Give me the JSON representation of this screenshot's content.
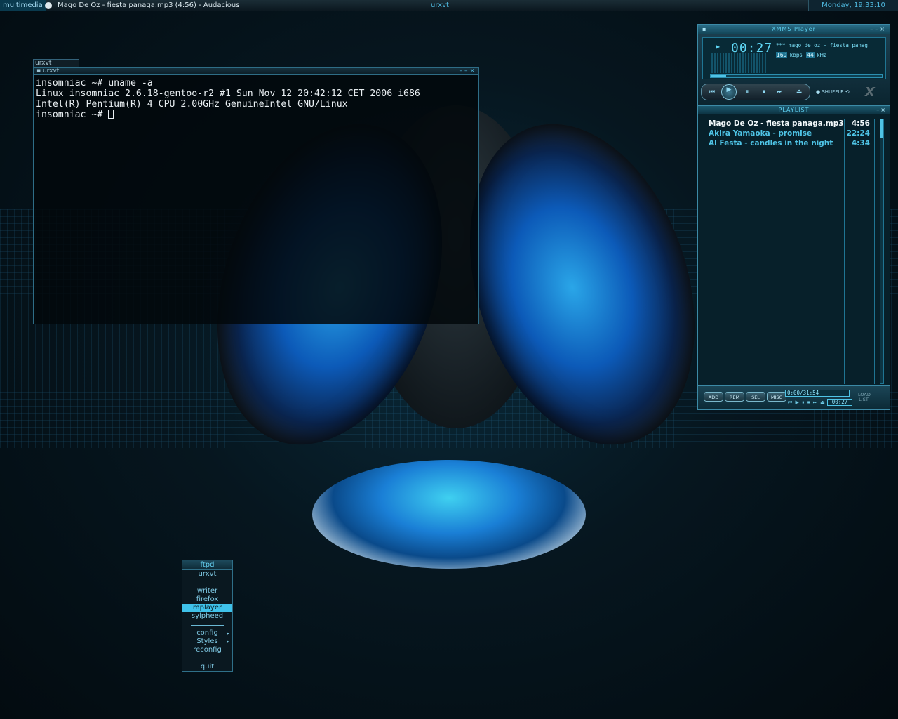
{
  "topbar": {
    "workspace": "multimedia",
    "window_title": "Mago De Oz - fiesta panaga.mp3 (4:56) - Audacious",
    "center_title": "urxvt",
    "clock": "Monday, 19:33:10"
  },
  "terminal": {
    "tab_label": "urxvt",
    "title": "urxvt",
    "lines": [
      "insomniac ~# uname -a",
      "Linux insomniac 2.6.18-gentoo-r2 #1 Sun Nov 12 20:42:12 CET 2006 i686",
      "Intel(R) Pentium(R) 4 CPU 2.00GHz GenuineIntel GNU/Linux",
      "insomniac ~# "
    ]
  },
  "player": {
    "title": "XMMS Player",
    "time": "00:27",
    "marquee": "*** mago de oz - fiesta panag",
    "kbps": "160",
    "kbps_unit": "kbps",
    "khz": "44",
    "khz_unit": "kHz",
    "seek_progress": 0.09,
    "shuffle_label": "SHUFFLE",
    "logo": "X"
  },
  "playlist": {
    "title": "PLAYLIST",
    "items": [
      {
        "title": "Mago De Oz - fiesta panaga.mp3",
        "time": "4:56"
      },
      {
        "title": "Akira Yamaoka - promise",
        "time": "22:24"
      },
      {
        "title": "Al Festa - candles in the night",
        "time": "4:34"
      }
    ],
    "buttons": {
      "add": "ADD",
      "rem": "REM",
      "sel": "SEL",
      "misc": "MISC"
    },
    "total_time": "0:00/31:54",
    "elapsed": "00:27",
    "load_list": "LOAD LIST"
  },
  "menu": {
    "title": "ftpd",
    "items": [
      "urxvt",
      "writer",
      "firefox",
      "mplayer",
      "sylpheed",
      "config",
      "Styles",
      "reconfig",
      "quit"
    ]
  },
  "colors": {
    "accent": "#3fc2ea",
    "background": "#06161f"
  }
}
